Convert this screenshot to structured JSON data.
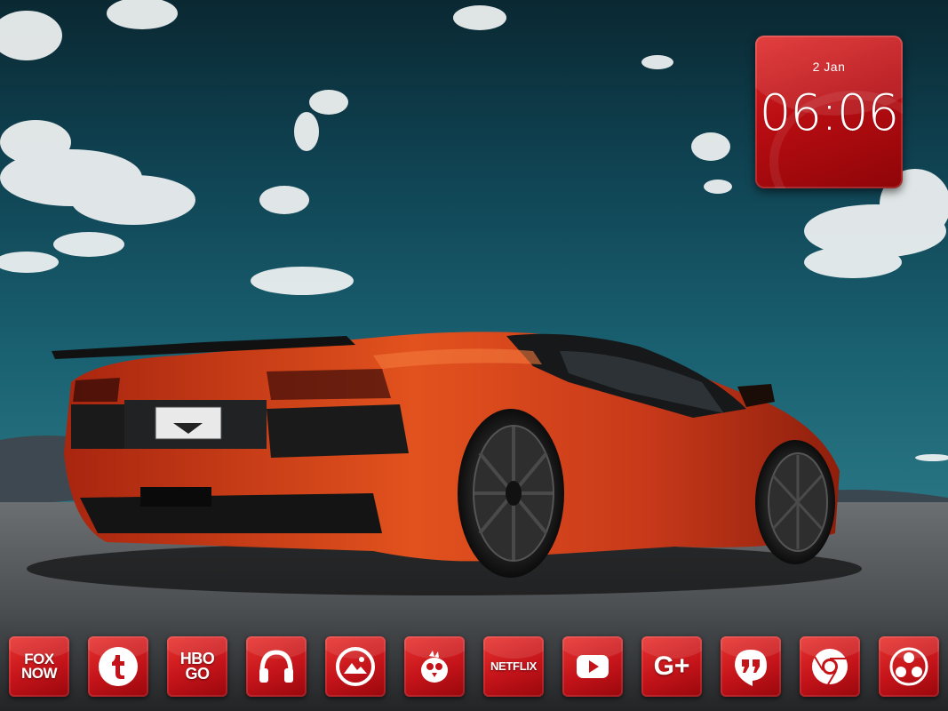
{
  "clock": {
    "date": "2 Jan",
    "time": "06:06"
  },
  "dock": {
    "apps": [
      {
        "name": "fox-now",
        "line1": "FOX",
        "line2": "NOW"
      },
      {
        "name": "tumblr",
        "icon": "tumblr-t-icon"
      },
      {
        "name": "hbo-go",
        "line1": "HBO",
        "line2": "GO"
      },
      {
        "name": "music",
        "icon": "headphones-icon"
      },
      {
        "name": "gallery",
        "icon": "mountain-photo-icon"
      },
      {
        "name": "bird-app",
        "icon": "bird-icon"
      },
      {
        "name": "netflix",
        "label": "NETFLIX"
      },
      {
        "name": "youtube",
        "icon": "play-icon"
      },
      {
        "name": "google-plus",
        "label": "G+"
      },
      {
        "name": "hangouts",
        "icon": "quote-bubble-icon"
      },
      {
        "name": "chrome",
        "icon": "chrome-icon"
      },
      {
        "name": "app-drawer",
        "icon": "dots-icon"
      }
    ]
  },
  "colors": {
    "icon_red": "#c4141a",
    "sky": "#155466",
    "car_orange": "#d9481c"
  }
}
